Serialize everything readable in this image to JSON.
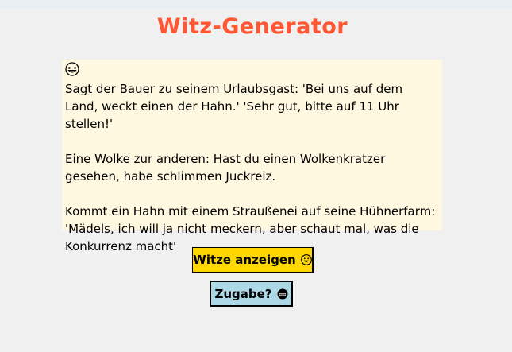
{
  "app": {
    "title": "Witz-Generator"
  },
  "jokes": [
    "Sagt der Bauer zu seinem Urlaubsgast: 'Bei uns auf dem Land, weckt einen der Hahn.'  'Sehr gut, bitte auf 11 Uhr stellen!'",
    "Eine Wolke zur anderen: Hast du einen Wolkenkratzer gesehen, habe schlimmen Juckreiz.",
    "Kommt ein Hahn mit einem Straußenei auf seine Hühnerfarm: 'Mädels, ich will ja nicht meckern, aber schaut mal, was die Konkurrenz macht'"
  ],
  "icons": {
    "joke_box": "squinting-laughing-face-icon",
    "show_button": "grinning-face-icon",
    "more_button": "grimacing-face-icon"
  },
  "buttons": {
    "show_label": "Witze anzeigen",
    "more_label": "Zugabe?"
  },
  "colors": {
    "title": "#ff5733",
    "joke_box_bg": "#fff8e1",
    "show_button_bg": "#ffd700",
    "more_button_bg": "#add8e6",
    "page_bg": "#f0f0f0"
  }
}
